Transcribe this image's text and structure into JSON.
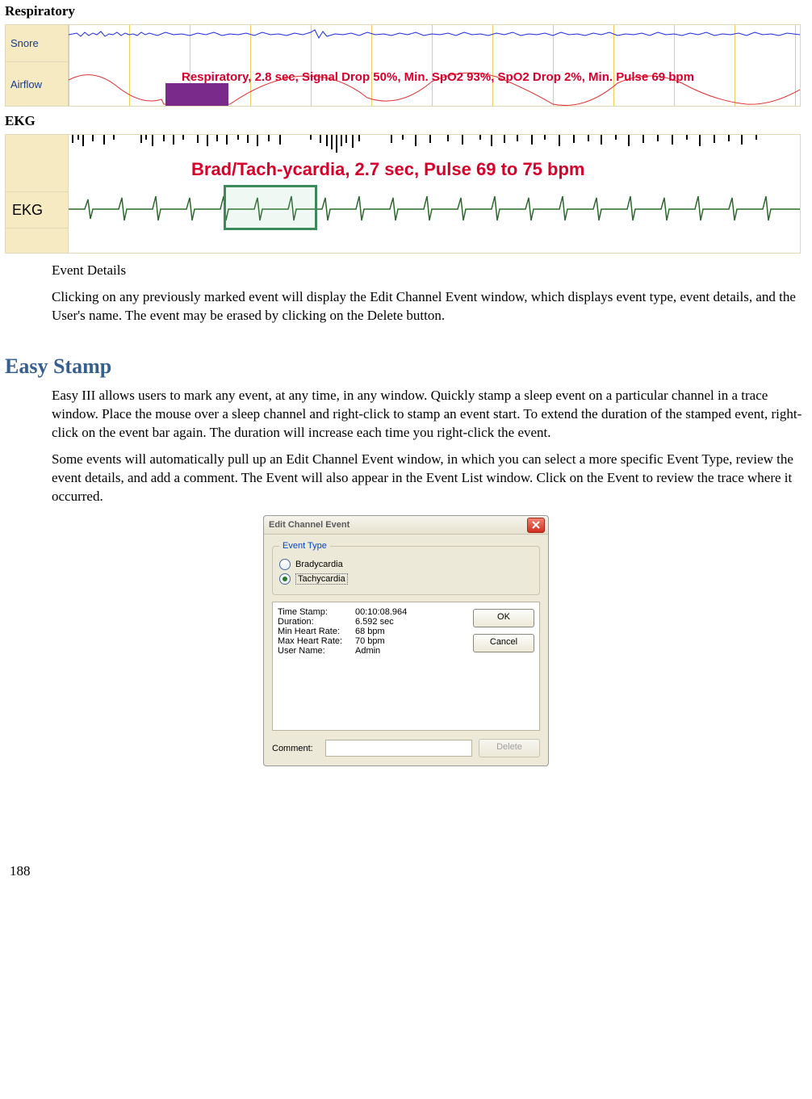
{
  "respiratory": {
    "heading": "Respiratory",
    "label_snore": "Snore",
    "label_airflow": "Airflow",
    "overlay_text": "Respiratory, 2.8 sec, Signal Drop 50%, Min. SpO2 93%, SpO2 Drop 2%, Min. Pulse 69 bpm"
  },
  "ekg": {
    "heading": "EKG",
    "label_ekg": "EKG",
    "overlay_text": "Brad/Tach-ycardia, 2.7 sec, Pulse 69 to 75 bpm"
  },
  "body": {
    "p1_title": "Event Details",
    "p1": "Clicking on any previously marked event will display the Edit Channel Event window, which displays event type, event details, and the User's name. The event may be erased by clicking on the Delete button.",
    "section_title": "Easy Stamp",
    "p2": "Easy III allows users to mark any event, at any time, in any window.  Quickly stamp a sleep event on a particular channel in a trace window. Place the mouse over a sleep channel and right-click to stamp an event start. To extend the duration of the stamped event, right-click on the event bar again. The duration will increase each time you right-click the event.",
    "p3": "Some events will automatically pull up an Edit Channel Event window, in which you can select a more specific Event Type, review the event details, and add a comment. The Event will also appear in the Event List window. Click on the Event to review the trace where it occurred."
  },
  "dialog": {
    "title": "Edit Channel Event",
    "legend": "Event Type",
    "radio1": "Bradycardia",
    "radio2": "Tachycardia",
    "details": {
      "time_stamp_k": "Time Stamp:",
      "time_stamp_v": "00:10:08.964",
      "duration_k": "Duration:",
      "duration_v": "6.592 sec",
      "min_hr_k": "Min Heart Rate:",
      "min_hr_v": "68 bpm",
      "max_hr_k": "Max Heart Rate:",
      "max_hr_v": "70 bpm",
      "user_k": "User Name:",
      "user_v": "Admin"
    },
    "ok": "OK",
    "cancel": "Cancel",
    "delete": "Delete",
    "comment_label": "Comment:"
  },
  "page_number": "188",
  "chart_data": [
    {
      "type": "line",
      "title": "Respiratory trace (Snore + Airflow channels)",
      "channels": [
        "Snore",
        "Airflow"
      ],
      "annotation": "Respiratory, 2.8 sec, Signal Drop 50%, Min. SpO2 93%, SpO2 Drop 2%, Min. Pulse 69 bpm",
      "event_marker": {
        "channel": "Airflow",
        "duration_sec": 2.8
      }
    },
    {
      "type": "line",
      "title": "EKG trace",
      "channels": [
        "EKG"
      ],
      "annotation": "Brad/Tach-ycardia, 2.7 sec, Pulse 69 to 75 bpm",
      "pulse_range_bpm": [
        69,
        75
      ],
      "event_marker": {
        "channel": "EKG",
        "duration_sec": 2.7
      }
    }
  ]
}
